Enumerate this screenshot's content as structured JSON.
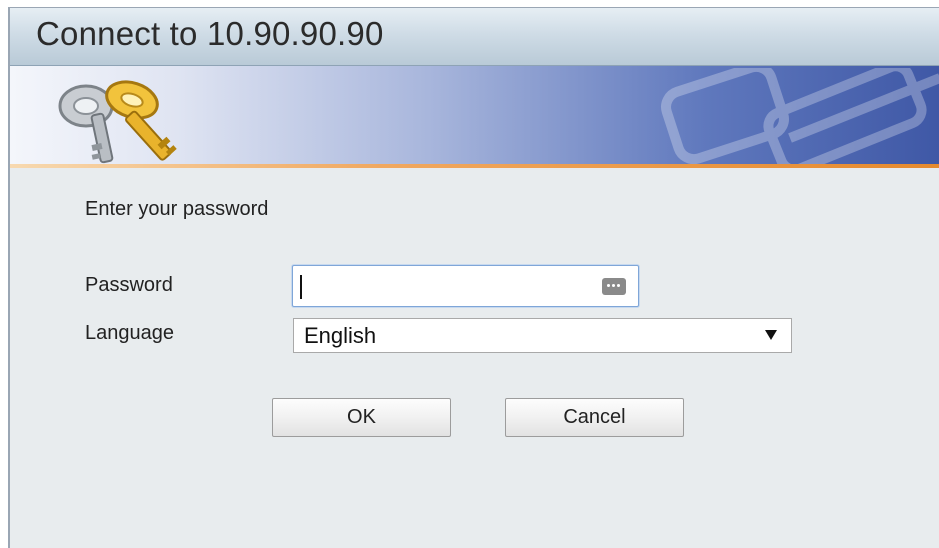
{
  "window": {
    "title": "Connect to 10.90.90.90"
  },
  "banner": {
    "icon": "keys-icon",
    "watermark_icon": "keys-watermark-icon"
  },
  "form": {
    "prompt": "Enter your password",
    "password": {
      "label": "Password",
      "value": "",
      "reveal_icon": "password-dots-icon"
    },
    "language": {
      "label": "Language",
      "selected": "English",
      "arrow_glyph": "▼"
    }
  },
  "buttons": {
    "ok": "OK",
    "cancel": "Cancel"
  },
  "colors": {
    "banner_blue": "#3f58a6",
    "accent_orange": "#e58a2e",
    "background": "#e8ecee"
  }
}
